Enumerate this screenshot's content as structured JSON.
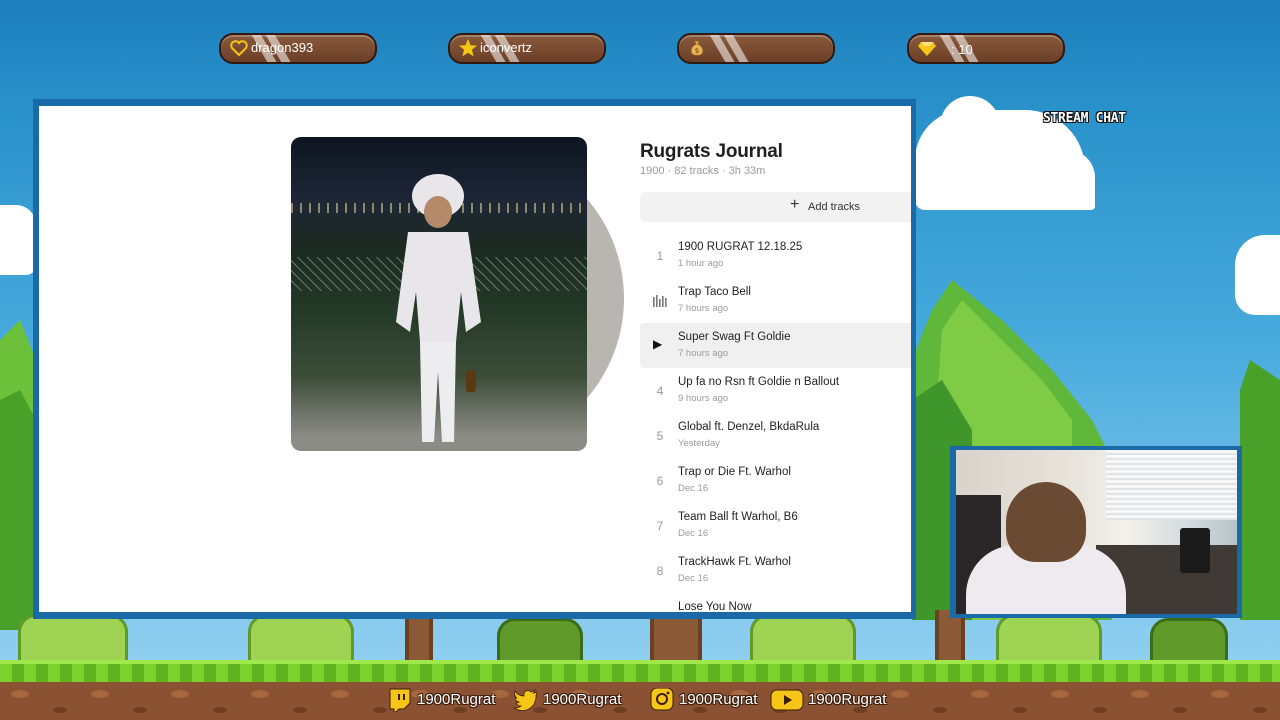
{
  "stats": {
    "follower": "dragon393",
    "subscriber": "iconvertz",
    "donation": "",
    "gems": ": 10"
  },
  "album": {
    "title": "Rugrats Journal",
    "meta": "1900 · 82 tracks · 3h 33m",
    "add_tracks_label": "Add tracks"
  },
  "tracks": [
    {
      "num": "1",
      "name": "1900 RUGRAT 12.18.25",
      "when": "1 hour ago",
      "state": "number"
    },
    {
      "num": "",
      "name": "Trap Taco Bell",
      "when": "7 hours ago",
      "state": "playing"
    },
    {
      "num": "",
      "name": "Super Swag Ft Goldie",
      "when": "7 hours ago",
      "state": "hover"
    },
    {
      "num": "4",
      "name": "Up fa no Rsn ft Goldie n Ballout",
      "when": "9 hours ago",
      "state": "number"
    },
    {
      "num": "5",
      "name": "Global ft. Denzel, BkdaRula",
      "when": "Yesterday",
      "state": "number"
    },
    {
      "num": "6",
      "name": "Trap or Die Ft. Warhol",
      "when": "Dec 16",
      "state": "number"
    },
    {
      "num": "7",
      "name": "Team Ball ft Warhol, B6",
      "when": "Dec 16",
      "state": "number"
    },
    {
      "num": "8",
      "name": "TrackHawk Ft. Warhol",
      "when": "Dec 16",
      "state": "number"
    },
    {
      "num": "",
      "name": "Lose You Now",
      "when": "",
      "state": "number"
    }
  ],
  "chat": {
    "title": "STREAM CHAT"
  },
  "socials": {
    "twitch": "1900Rugrat",
    "twitter": "1900Rugrat",
    "instagram": "1900Rugrat",
    "youtube": "1900Rugrat"
  },
  "colors": {
    "sky": "#2b93cb",
    "grass": "#7cd12c",
    "dirt": "#8a5232",
    "pill": "#6b3f27",
    "panel": "#ffffff"
  },
  "icons": {
    "follower": "heart-icon",
    "subscriber": "star-icon",
    "donation": "money-bag-icon",
    "gems": "diamond-icon"
  }
}
